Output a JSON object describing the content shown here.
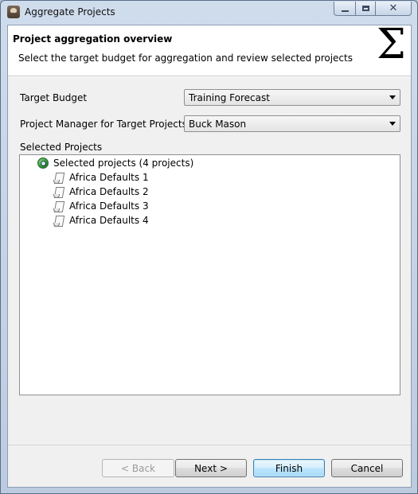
{
  "window": {
    "title": "Aggregate Projects",
    "minimize_label": "",
    "close_label": "✕"
  },
  "banner": {
    "title": "Project aggregation overview",
    "description": "Select the target budget for aggregation and review selected projects",
    "icon": "sigma-icon"
  },
  "form": {
    "target_budget_label": "Target Budget",
    "target_budget_value": "Training Forecast",
    "project_manager_label": "Project Manager for Target Projects",
    "project_manager_value": "Buck Mason",
    "selected_projects_label": "Selected Projects"
  },
  "tree": {
    "root": "Selected projects (4 projects)",
    "items": [
      "Africa Defaults 1",
      "Africa Defaults 2",
      "Africa Defaults 3",
      "Africa Defaults 4"
    ]
  },
  "buttons": {
    "back": "< Back",
    "next": "Next >",
    "finish": "Finish",
    "cancel": "Cancel"
  }
}
